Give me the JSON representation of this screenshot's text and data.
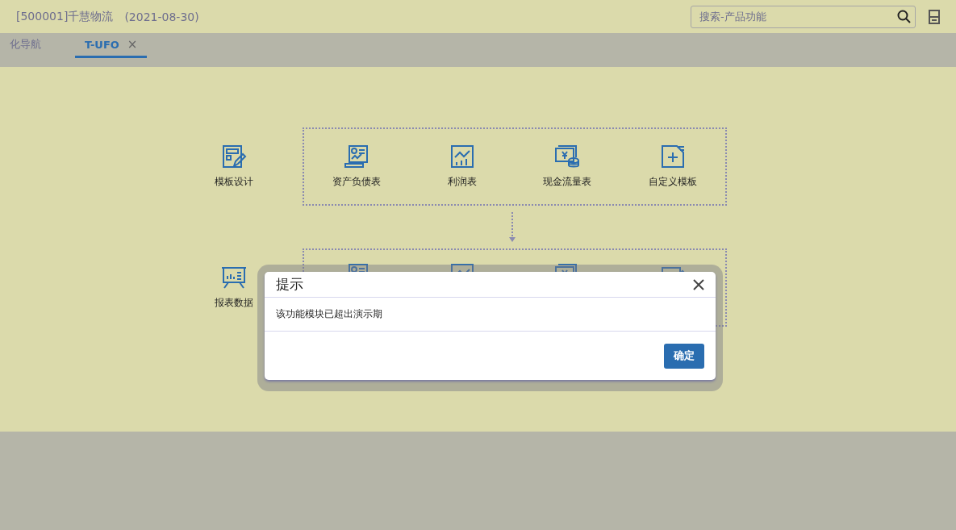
{
  "header": {
    "title": "[500001]千慧物流",
    "date": "(2021-08-30)",
    "search": {
      "placeholder": "搜索-产品功能"
    }
  },
  "tabs": [
    {
      "label": "化导航",
      "selected": false
    },
    {
      "label": "T-UFO",
      "selected": true,
      "close": "×"
    }
  ],
  "flow": {
    "rows": [
      {
        "entry": {
          "label": "模板设计"
        },
        "items": [
          {
            "label": "资产负债表"
          },
          {
            "label": "利润表"
          },
          {
            "label": "现金流量表"
          },
          {
            "label": "自定义模板"
          }
        ]
      },
      {
        "entry": {
          "label": "报表数据"
        }
      }
    ]
  },
  "dialog": {
    "title": "提示",
    "message": "该功能模块已超出演示期",
    "buttons": [
      "确定"
    ]
  }
}
